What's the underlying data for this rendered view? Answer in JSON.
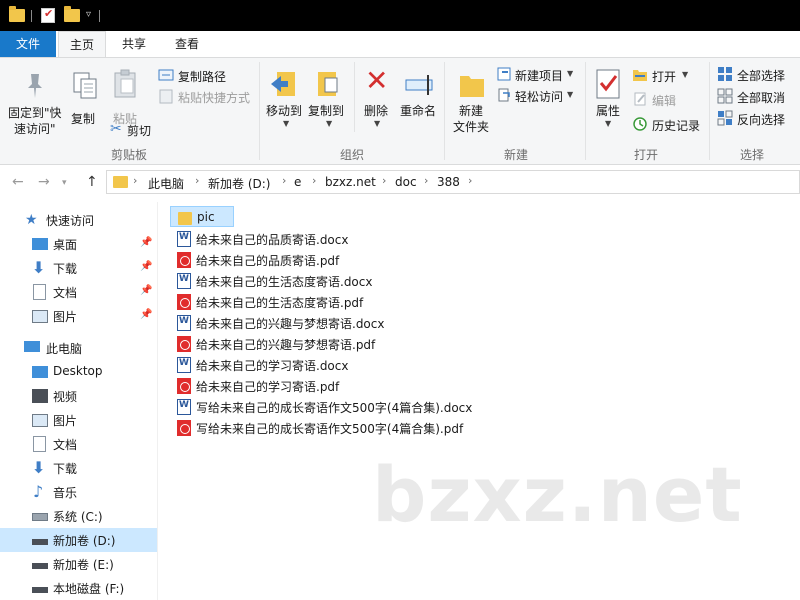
{
  "ribbon_tabs": {
    "file": "文件",
    "home": "主页",
    "share": "共享",
    "view": "查看"
  },
  "ribbon": {
    "clipboard": {
      "label": "剪贴板",
      "pin_quick_access": "固定到\"快",
      "pin_quick_access_2": "速访问\"",
      "copy": "复制",
      "paste": "粘贴",
      "copy_path": "复制路径",
      "paste_shortcut": "粘贴快捷方式",
      "cut": "剪切"
    },
    "organize": {
      "label": "组织",
      "move_to": "移动到",
      "copy_to": "复制到",
      "delete": "删除",
      "rename": "重命名"
    },
    "new": {
      "label": "新建",
      "new_folder": "新建",
      "new_folder_2": "文件夹",
      "new_item": "新建项目",
      "easy_access": "轻松访问"
    },
    "open": {
      "label": "打开",
      "properties": "属性",
      "open": "打开",
      "edit": "编辑",
      "history": "历史记录"
    },
    "select": {
      "label": "选择",
      "select_all": "全部选择",
      "select_none": "全部取消",
      "invert": "反向选择"
    }
  },
  "address": {
    "crumbs": [
      "此电脑",
      "新加卷 (D:)",
      "e",
      "bzxz.net",
      "doc",
      "388"
    ]
  },
  "nav": {
    "quick_access": "快速访问",
    "desktop_pinned": "桌面",
    "downloads_pinned": "下载",
    "documents_pinned": "文档",
    "pictures_pinned": "图片",
    "this_pc": "此电脑",
    "desktop": "Desktop",
    "videos": "视频",
    "pictures": "图片",
    "documents": "文档",
    "downloads": "下载",
    "music": "音乐",
    "drive_c": "系统 (C:)",
    "drive_d": "新加卷 (D:)",
    "drive_e": "新加卷 (E:)",
    "drive_f": "本地磁盘 (F:)"
  },
  "files": [
    {
      "name": "pic",
      "type": "folder"
    },
    {
      "name": "给未来自己的品质寄语.docx",
      "type": "docx"
    },
    {
      "name": "给未来自己的品质寄语.pdf",
      "type": "pdf"
    },
    {
      "name": "给未来自己的生活态度寄语.docx",
      "type": "docx"
    },
    {
      "name": "给未来自己的生活态度寄语.pdf",
      "type": "pdf"
    },
    {
      "name": "给未来自己的兴趣与梦想寄语.docx",
      "type": "docx"
    },
    {
      "name": "给未来自己的兴趣与梦想寄语.pdf",
      "type": "pdf"
    },
    {
      "name": "给未来自己的学习寄语.docx",
      "type": "docx"
    },
    {
      "name": "给未来自己的学习寄语.pdf",
      "type": "pdf"
    },
    {
      "name": "写给未来自己的成长寄语作文500字(4篇合集).docx",
      "type": "docx"
    },
    {
      "name": "写给未来自己的成长寄语作文500字(4篇合集).pdf",
      "type": "pdf"
    }
  ],
  "watermark": "bzxz.net",
  "colors": {
    "accent": "#1979ca",
    "selection": "#cce8ff",
    "folder": "#f2c64b",
    "pdf": "#e02c2c",
    "word": "#2b579a"
  }
}
